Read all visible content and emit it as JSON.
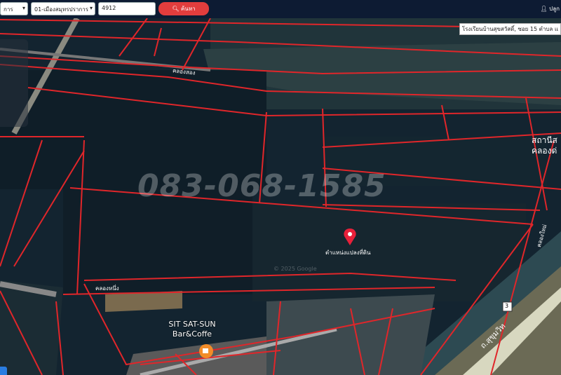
{
  "toolbar": {
    "province_select": "การ",
    "district_select": "01-เมืองสมุทรปราการ",
    "parcel_input": "4912",
    "search_button": "ค้นหา",
    "user_label": "ปลูก"
  },
  "map": {
    "address_tag": "โรงเรียนบ้านสุขสวัสดิ์, ซอย 15 ตำบล แ",
    "watermark": "083-068-1585",
    "marker_label": "ตำแหน่งแปลงที่ดิน",
    "canal_labels": [
      "คลองสอง",
      "คลองหนึ่ง",
      "คลองใหม่"
    ],
    "station_label": [
      "สถานีส",
      "คลองด่"
    ],
    "poi_name": "SIT SAT-SUN Bar&Coffe",
    "copyright": "© 2025 Google",
    "road_label": "ถ.สุขุมวิท",
    "route_shield": "3"
  },
  "colors": {
    "topbar": "#0d1b33",
    "parcel_line": "#e0262a",
    "accent_button": "#e23d3d",
    "marker": "#e8203a"
  },
  "icons": [
    "user-icon",
    "search-icon",
    "map-pin-icon",
    "coffee-icon",
    "chevron-down-icon"
  ]
}
